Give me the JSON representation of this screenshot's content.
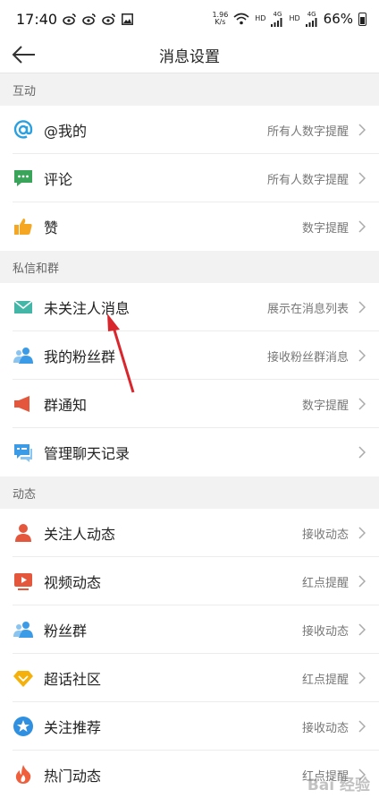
{
  "status_bar": {
    "time": "17:40",
    "net_speed": "1.96",
    "net_unit": "K/s",
    "hd1": "HD",
    "sig1": "4G",
    "hd2": "HD",
    "sig2": "4G",
    "battery": "66%"
  },
  "header": {
    "title": "消息设置"
  },
  "sections": [
    {
      "title": "互动",
      "items": [
        {
          "label": "@我的",
          "value": "所有人数字提醒",
          "icon": "at-icon"
        },
        {
          "label": "评论",
          "value": "所有人数字提醒",
          "icon": "comment-icon"
        },
        {
          "label": "赞",
          "value": "数字提醒",
          "icon": "thumbs-up-icon"
        }
      ]
    },
    {
      "title": "私信和群",
      "items": [
        {
          "label": "未关注人消息",
          "value": "展示在消息列表",
          "icon": "mail-icon"
        },
        {
          "label": "我的粉丝群",
          "value": "接收粉丝群消息",
          "icon": "people-icon"
        },
        {
          "label": "群通知",
          "value": "数字提醒",
          "icon": "megaphone-icon"
        },
        {
          "label": "管理聊天记录",
          "value": "",
          "icon": "chat-icon"
        }
      ]
    },
    {
      "title": "动态",
      "items": [
        {
          "label": "关注人动态",
          "value": "接收动态",
          "icon": "person-icon"
        },
        {
          "label": "视频动态",
          "value": "红点提醒",
          "icon": "video-icon"
        },
        {
          "label": "粉丝群",
          "value": "接收动态",
          "icon": "fans-group-icon"
        },
        {
          "label": "超话社区",
          "value": "红点提醒",
          "icon": "diamond-icon"
        },
        {
          "label": "关注推荐",
          "value": "接收动态",
          "icon": "star-badge-icon"
        },
        {
          "label": "热门动态",
          "value": "红点提醒",
          "icon": "flame-icon"
        }
      ]
    }
  ],
  "watermark": "Bai 经验",
  "colors": {
    "at_blue": "#2aa0e0",
    "comment_green": "#3aa55a",
    "like_orange": "#f5a623",
    "mail_teal": "#43b6a8",
    "people_blue": "#3c9be6",
    "megaphone_red": "#e5573c",
    "chat_blue": "#3c9be6",
    "person_red": "#e5573c",
    "video_red": "#e5573c",
    "diamond_orange": "#f5b10a",
    "star_blue": "#2f8fe0",
    "flame_red": "#ef5f3c",
    "annotation_arrow": "#d9262c"
  }
}
